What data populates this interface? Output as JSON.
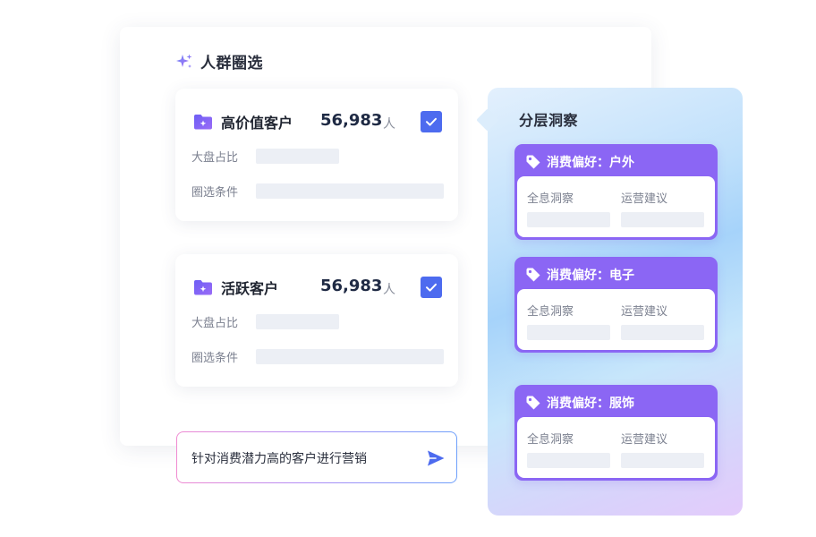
{
  "panel": {
    "title": "人群圈选"
  },
  "segments": [
    {
      "name": "高价值客户",
      "count": "56,983",
      "unit": "人",
      "checked": true,
      "share_label": "大盘占比",
      "criteria_label": "圈选条件"
    },
    {
      "name": "活跃客户",
      "count": "56,983",
      "unit": "人",
      "checked": true,
      "share_label": "大盘占比",
      "criteria_label": "圈选条件"
    }
  ],
  "prompt": {
    "text": "针对消费潜力高的客户进行营销"
  },
  "insight": {
    "title": "分层洞察",
    "cards": [
      {
        "tag": "消费偏好：户外",
        "col1": "全息洞察",
        "col2": "运营建议"
      },
      {
        "tag": "消费偏好：电子",
        "col1": "全息洞察",
        "col2": "运营建议"
      },
      {
        "tag": "消费偏好：服饰",
        "col1": "全息洞察",
        "col2": "运营建议"
      }
    ]
  },
  "colors": {
    "accent": "#4d6bef",
    "tag_purple": "#8b66f4",
    "placeholder_bar": "#eceff5"
  },
  "icons": {
    "header": "sparkle-icon",
    "segment": "folder-sparkle-icon",
    "checkbox": "checkmark-icon",
    "send": "send-icon",
    "tag": "tag-icon"
  }
}
